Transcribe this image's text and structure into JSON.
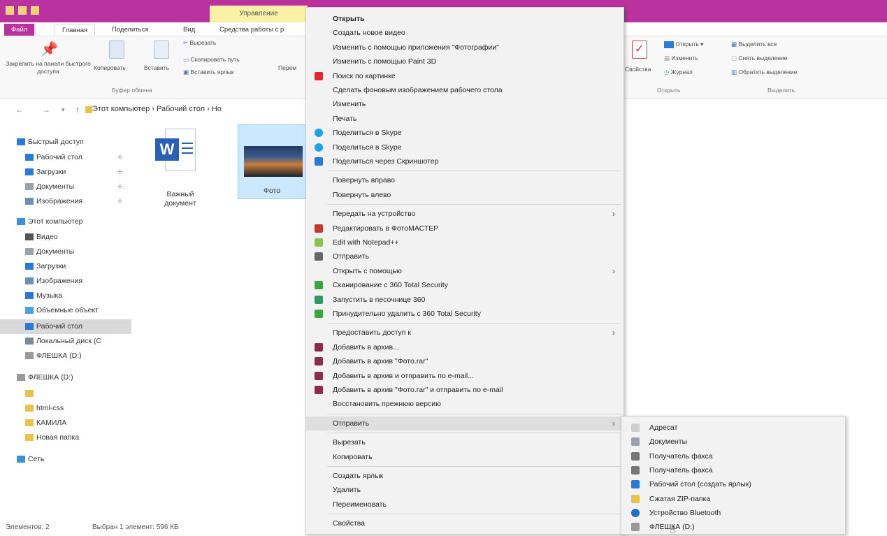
{
  "window": {
    "manage_tab": "Управление",
    "tabs": [
      "Файл",
      "Главная",
      "Поделиться",
      "Вид",
      "Средства работы с р"
    ]
  },
  "ribbon": {
    "pin_label": "Закрепить на панели быстрого доступа",
    "copy_label": "Копировать",
    "paste_label": "Вставить",
    "cut_label": "Вырезать",
    "copy_path_label": "Скопировать путь",
    "paste_shortcut_label": "Вставить ярлык",
    "move_label": "Перем",
    "clipboard_group": "Буфер обмена",
    "properties_label": "Свойства",
    "open_label": "Открыть",
    "edit_label": "Изменить",
    "history_label": "Журнал",
    "open_group": "Открыть",
    "select_all_label": "Выделить все",
    "select_none_label": "Снять выделение",
    "invert_selection_label": "Обратить выделение",
    "select_group": "Выделить"
  },
  "address": {
    "path": "Этот компьютер  ›  Рабочий стол  ›  Но"
  },
  "sidebar": {
    "items": [
      {
        "label": "Быстрый доступ",
        "top": true,
        "color": "#2b79d6",
        "pin": false
      },
      {
        "label": "Рабочий стол",
        "top": false,
        "color": "#2b79d6",
        "pin": true
      },
      {
        "label": "Загрузки",
        "top": false,
        "color": "#2b79d6",
        "pin": true
      },
      {
        "label": "Документы",
        "top": false,
        "color": "#9aa3ad",
        "pin": true
      },
      {
        "label": "Изображения",
        "top": false,
        "color": "#6b8fb5",
        "pin": true
      },
      {
        "label": "Этот компьютер",
        "top": true,
        "color": "#3d8fd9",
        "pin": false
      },
      {
        "label": "Видео",
        "top": false,
        "color": "#555",
        "pin": false
      },
      {
        "label": "Документы",
        "top": false,
        "color": "#9aa3ad",
        "pin": false
      },
      {
        "label": "Загрузки",
        "top": false,
        "color": "#2b79d6",
        "pin": false
      },
      {
        "label": "Изображения",
        "top": false,
        "color": "#6b8fb5",
        "pin": false
      },
      {
        "label": "Музыка",
        "top": false,
        "color": "#2b79d6",
        "pin": false
      },
      {
        "label": "Объемные объект",
        "top": false,
        "color": "#4aa0e0",
        "pin": false
      },
      {
        "label": "Рабочий стол",
        "top": false,
        "color": "#2b79d6",
        "pin": false,
        "selected": true
      },
      {
        "label": "Локальный диск (C",
        "top": false,
        "color": "#7a8a99",
        "pin": false
      },
      {
        "label": "ФЛЕШКА (D:)",
        "top": false,
        "color": "#999",
        "pin": false
      },
      {
        "label": "ФЛЕШКА (D:)",
        "top": true,
        "color": "#999",
        "pin": false
      },
      {
        "label": "",
        "top": false,
        "color": "#e8c34a",
        "pin": false
      },
      {
        "label": "html-css",
        "top": false,
        "color": "#e8c34a",
        "pin": false
      },
      {
        "label": "КАМИЛА",
        "top": false,
        "color": "#e8c34a",
        "pin": false
      },
      {
        "label": "Новая папка",
        "top": false,
        "color": "#e8c34a",
        "pin": false
      },
      {
        "label": "Сеть",
        "top": true,
        "color": "#3d8fd9",
        "pin": false
      }
    ]
  },
  "files": {
    "word_name": "Важный документ",
    "photo_name": "Фото"
  },
  "status": {
    "count": "Элементов: 2",
    "selected": "Выбран 1 элемент: 596 КБ"
  },
  "context_menu": {
    "items": [
      {
        "label": "Открыть",
        "bold": true
      },
      {
        "label": "Создать новое видео"
      },
      {
        "label": "Изменить с помощью приложения \"Фотографии\""
      },
      {
        "label": "Изменить с помощью Paint 3D"
      },
      {
        "label": "Поиск по картинке",
        "icon": "yandex-icon",
        "color": "#e0282e"
      },
      {
        "label": "Сделать фоновым изображением рабочего стола"
      },
      {
        "label": "Изменить"
      },
      {
        "label": "Печать"
      },
      {
        "label": "Поделиться в Skype",
        "icon": "skype-icon",
        "color": "#1aa3e8"
      },
      {
        "label": "Поделиться в Skype",
        "icon": "skype-icon",
        "color": "#1aa3e8"
      },
      {
        "label": "Поделиться через Скриншотер",
        "icon": "screenshot-icon",
        "color": "#2b79d6"
      },
      {
        "sep": true
      },
      {
        "label": "Повернуть вправо"
      },
      {
        "label": "Повернуть влево"
      },
      {
        "sep": true
      },
      {
        "label": "Передать на устройство",
        "arrow": true
      },
      {
        "label": "Редактировать в ФотоМАСТЕР",
        "icon": "fotomaster-icon",
        "color": "#c0392b"
      },
      {
        "label": "Edit with Notepad++",
        "icon": "notepad-icon",
        "color": "#8bc34a"
      },
      {
        "label": "Отправить",
        "icon": "share-icon",
        "color": "#666"
      },
      {
        "label": "Открыть с помощью",
        "arrow": true
      },
      {
        "label": "Сканирование с 360 Total Security",
        "icon": "360-icon",
        "color": "#3aa63a"
      },
      {
        "label": "Запустить в песочнице 360",
        "icon": "sandbox-icon",
        "color": "#2d9a6a"
      },
      {
        "label": "Принудительно удалить с  360 Total Security",
        "icon": "360-icon",
        "color": "#3aa63a"
      },
      {
        "sep": true
      },
      {
        "label": "Предоставить доступ к",
        "arrow": true
      },
      {
        "label": "Добавить в архив...",
        "icon": "winrar-icon",
        "color": "#8e2a4a"
      },
      {
        "label": "Добавить в архив \"Фото.rar\"",
        "icon": "winrar-icon",
        "color": "#8e2a4a"
      },
      {
        "label": "Добавить в архив и отправить по e-mail...",
        "icon": "winrar-icon",
        "color": "#8e2a4a"
      },
      {
        "label": "Добавить в архив \"Фото.rar\" и отправить по e-mail",
        "icon": "winrar-icon",
        "color": "#8e2a4a"
      },
      {
        "label": "Восстановить прежнюю версию"
      },
      {
        "sep": true
      },
      {
        "label": "Отправить",
        "arrow": true,
        "highlight": true
      },
      {
        "sep": true
      },
      {
        "label": "Вырезать"
      },
      {
        "label": "Копировать"
      },
      {
        "sep": true
      },
      {
        "label": "Создать ярлык"
      },
      {
        "label": "Удалить"
      },
      {
        "label": "Переименовать"
      },
      {
        "sep": true
      },
      {
        "label": "Свойства"
      }
    ]
  },
  "submenu": {
    "items": [
      {
        "label": "Адресат",
        "icon": "contact-icon",
        "color": "#cfcfcf"
      },
      {
        "label": "Документы",
        "icon": "documents-icon",
        "color": "#9aa3ad"
      },
      {
        "label": "Получатель факса",
        "icon": "fax-icon",
        "color": "#777"
      },
      {
        "label": "Получатель факса",
        "icon": "fax-icon",
        "color": "#777"
      },
      {
        "label": "Рабочий стол (создать ярлык)",
        "icon": "desktop-icon",
        "color": "#2b79d6"
      },
      {
        "label": "Сжатая ZIP-папка",
        "icon": "zip-icon",
        "color": "#e8c34a"
      },
      {
        "label": "Устройство Bluetooth",
        "icon": "bluetooth-icon",
        "color": "#1f6fd1"
      },
      {
        "label": "ФЛЕШКА (D:)",
        "icon": "usb-drive-icon",
        "color": "#999"
      }
    ]
  }
}
